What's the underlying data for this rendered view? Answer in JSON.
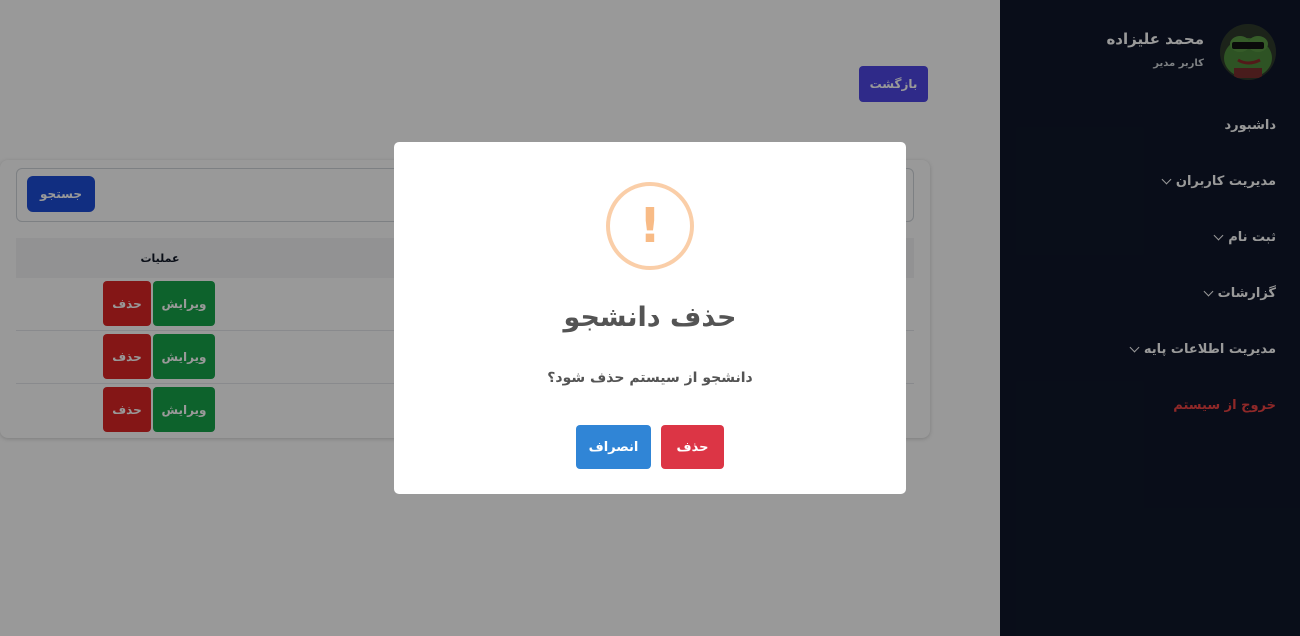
{
  "header": {
    "back_label": "بازگشت"
  },
  "search": {
    "button_label": "جستجو"
  },
  "table": {
    "columns": [
      "عملیات"
    ],
    "rows": [
      {
        "edit_label": "ویرایش",
        "delete_label": "حذف"
      },
      {
        "edit_label": "ویرایش",
        "delete_label": "حذف"
      },
      {
        "edit_label": "ویرایش",
        "delete_label": "حذف"
      }
    ]
  },
  "sidebar": {
    "user_name": "محمد علیزاده",
    "user_role": "کاربر مدیر",
    "items": [
      {
        "label": "داشبورد"
      },
      {
        "label": "مدیریت کاربران"
      },
      {
        "label": "ثبت نام"
      },
      {
        "label": "گزارشات"
      },
      {
        "label": "مدیریت اطلاعات پایه"
      },
      {
        "label": "خروج از سیستم"
      }
    ]
  },
  "modal": {
    "icon": "warning-icon",
    "icon_glyph": "!",
    "title": "حذف دانشجو",
    "text": "دانشجو از سیستم حذف شود؟",
    "confirm_label": "حذف",
    "cancel_label": "انصراف"
  },
  "colors": {
    "sidebar_bg": "#0f172a",
    "primary": "#4f46e5",
    "search": "#1d4ed8",
    "success": "#16a34a",
    "danger": "#dc2626",
    "modal_confirm": "#dc3545",
    "modal_cancel": "#3085d6",
    "warning": "#f8bb86"
  }
}
